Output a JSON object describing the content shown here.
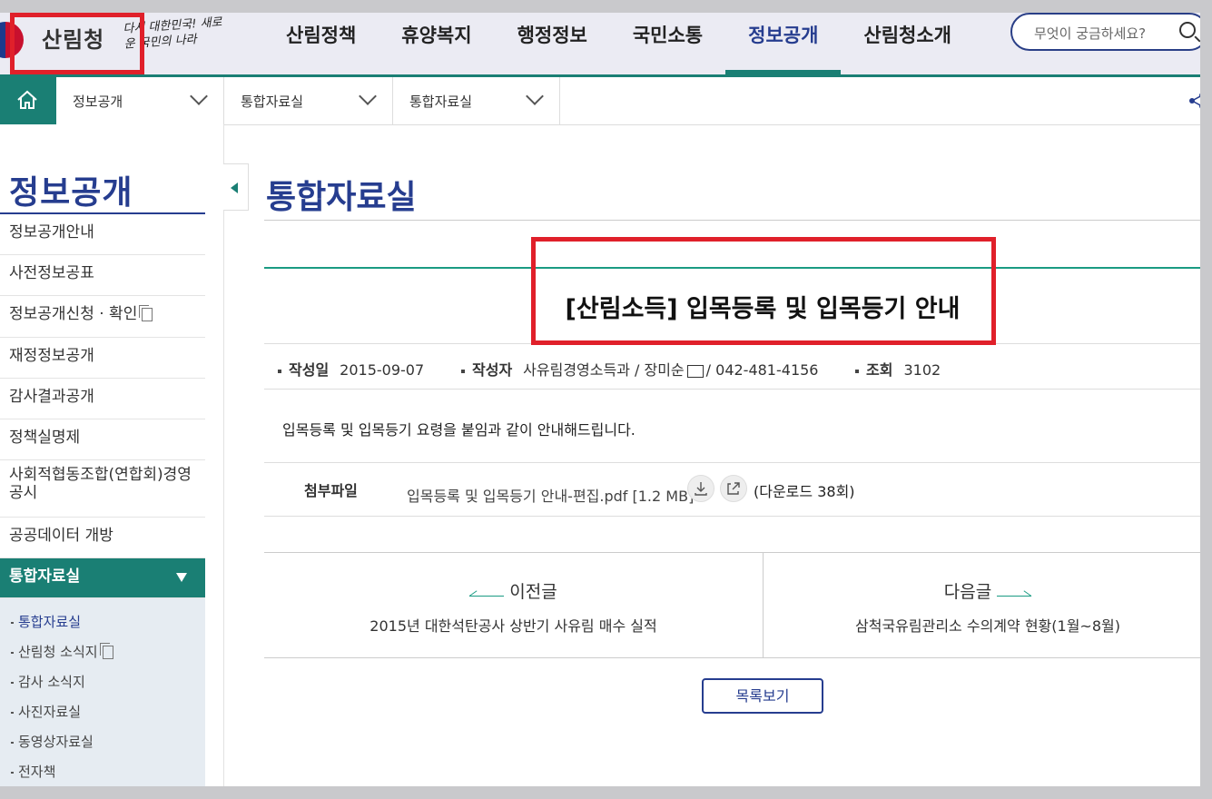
{
  "header": {
    "logo_text": "산림청",
    "slogan": "다시 대한민국! 새로운 국민의 나라",
    "nav": [
      "산림정책",
      "휴양복지",
      "행정정보",
      "국민소통",
      "정보공개",
      "산림청소개"
    ],
    "active_nav": "정보공개",
    "search_placeholder": "무엇이 궁금하세요?"
  },
  "breadcrumb": [
    "정보공개",
    "통합자료실",
    "통합자료실"
  ],
  "sidebar": {
    "title": "정보공개",
    "items": [
      "정보공개안내",
      "사전정보공표",
      "정보공개신청 · 확인",
      "재정정보공개",
      "감사결과공개",
      "정책실명제",
      "사회적협동조합(연합회)경영공시",
      "공공데이터 개방",
      "통합자료실"
    ],
    "sub_items": [
      "통합자료실",
      "산림청 소식지",
      "감사 소식지",
      "사진자료실",
      "동영상자료실",
      "전자책"
    ]
  },
  "content": {
    "page_title": "통합자료실",
    "post_title": "[산림소득] 입목등록 및 입목등기 안내",
    "meta": {
      "date_label": "작성일",
      "date": "2015-09-07",
      "author_label": "작성자",
      "author_dept": "사유림경영소득과 / 장미순",
      "author_phone": "/ 042-481-4156",
      "views_label": "조회",
      "views": "3102"
    },
    "body": "입목등록 및 입목등기 요령을 붙임과 같이 안내해드립니다.",
    "attachment": {
      "label": "첨부파일",
      "file": "입목등록 및 입목등기 안내-편집.pdf [1.2 MB]",
      "downloads": "(다운로드 38회)"
    },
    "prev": {
      "label": "이전글",
      "title": "2015년 대한석탄공사 상반기 사유림 매수 실적"
    },
    "next": {
      "label": "다음글",
      "title": "삼척국유림관리소 수의계약 현황(1월~8월)"
    },
    "list_button": "목록보기"
  }
}
